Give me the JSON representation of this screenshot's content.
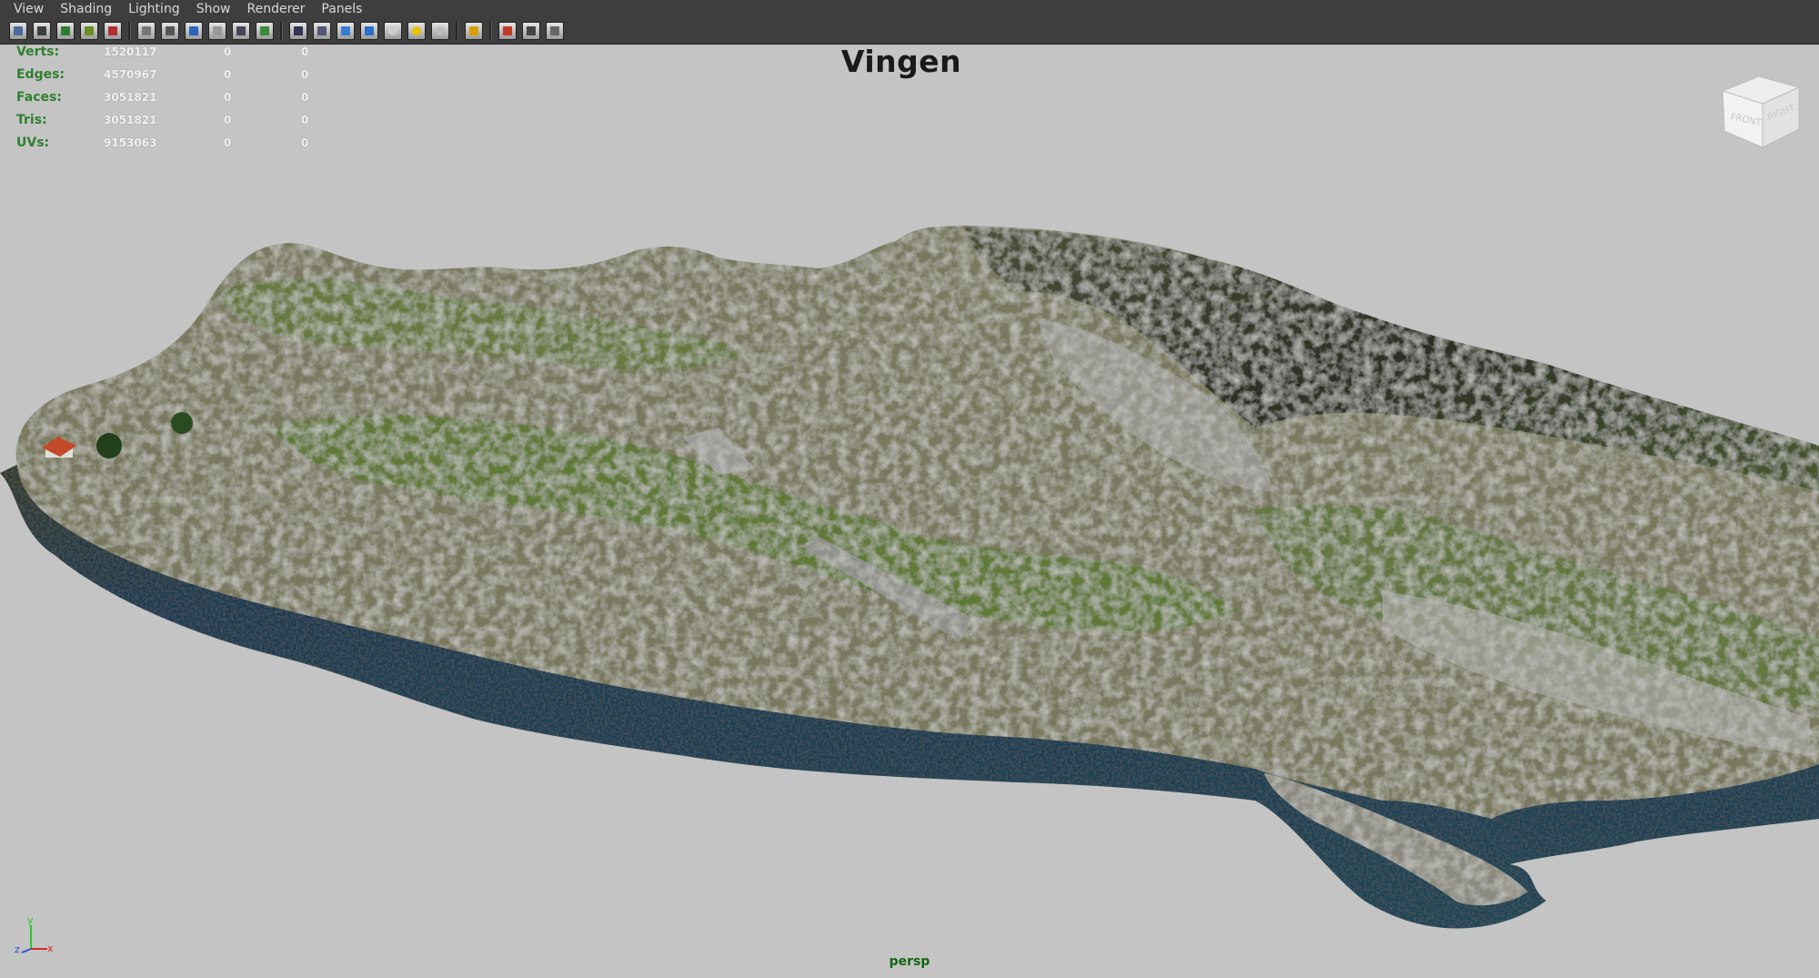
{
  "menu": [
    "View",
    "Shading",
    "Lighting",
    "Show",
    "Renderer",
    "Panels"
  ],
  "toolbar": {
    "groups": [
      [
        "select-camera-icon",
        "camera-attributes-icon",
        "bookmark-icon",
        "image-plane-icon",
        "two-d-pan-zoom-icon"
      ],
      [
        "grid-icon",
        "film-gate-icon",
        "resolution-gate-icon",
        "gate-mask-icon",
        "field-chart-icon",
        "safe-action-icon"
      ],
      [
        "wireframe-icon",
        "smooth-shade-icon",
        "default-material-icon",
        "textured-icon",
        "use-default-lighting-icon",
        "shadows-icon",
        "ambient-occlusion-icon"
      ],
      [
        "isolate-select-icon"
      ],
      [
        "xray-icon",
        "xray-joints-icon",
        "xray-components-icon"
      ]
    ]
  },
  "hud": {
    "stats": [
      {
        "label": "Verts:",
        "values": [
          "1520117",
          "0",
          "0"
        ]
      },
      {
        "label": "Edges:",
        "values": [
          "4570967",
          "0",
          "0"
        ]
      },
      {
        "label": "Faces:",
        "values": [
          "3051821",
          "0",
          "0"
        ]
      },
      {
        "label": "Tris:",
        "values": [
          "3051821",
          "0",
          "0"
        ]
      },
      {
        "label": "UVs:",
        "values": [
          "9153063",
          "0",
          "0"
        ]
      }
    ]
  },
  "viewport": {
    "title": "Vingen",
    "camera": "persp",
    "viewcube": {
      "front": "FRONT",
      "right": "RIGHT"
    },
    "axes": {
      "x": "x",
      "y": "y",
      "z": "z"
    },
    "colors": {
      "background": "#c4c4c4",
      "hud_label": "#2f7f2f",
      "grass": "#5f7a34",
      "rock": "#8e8e86",
      "cliff": "#3a3a30",
      "water": "#1e3e52"
    }
  }
}
